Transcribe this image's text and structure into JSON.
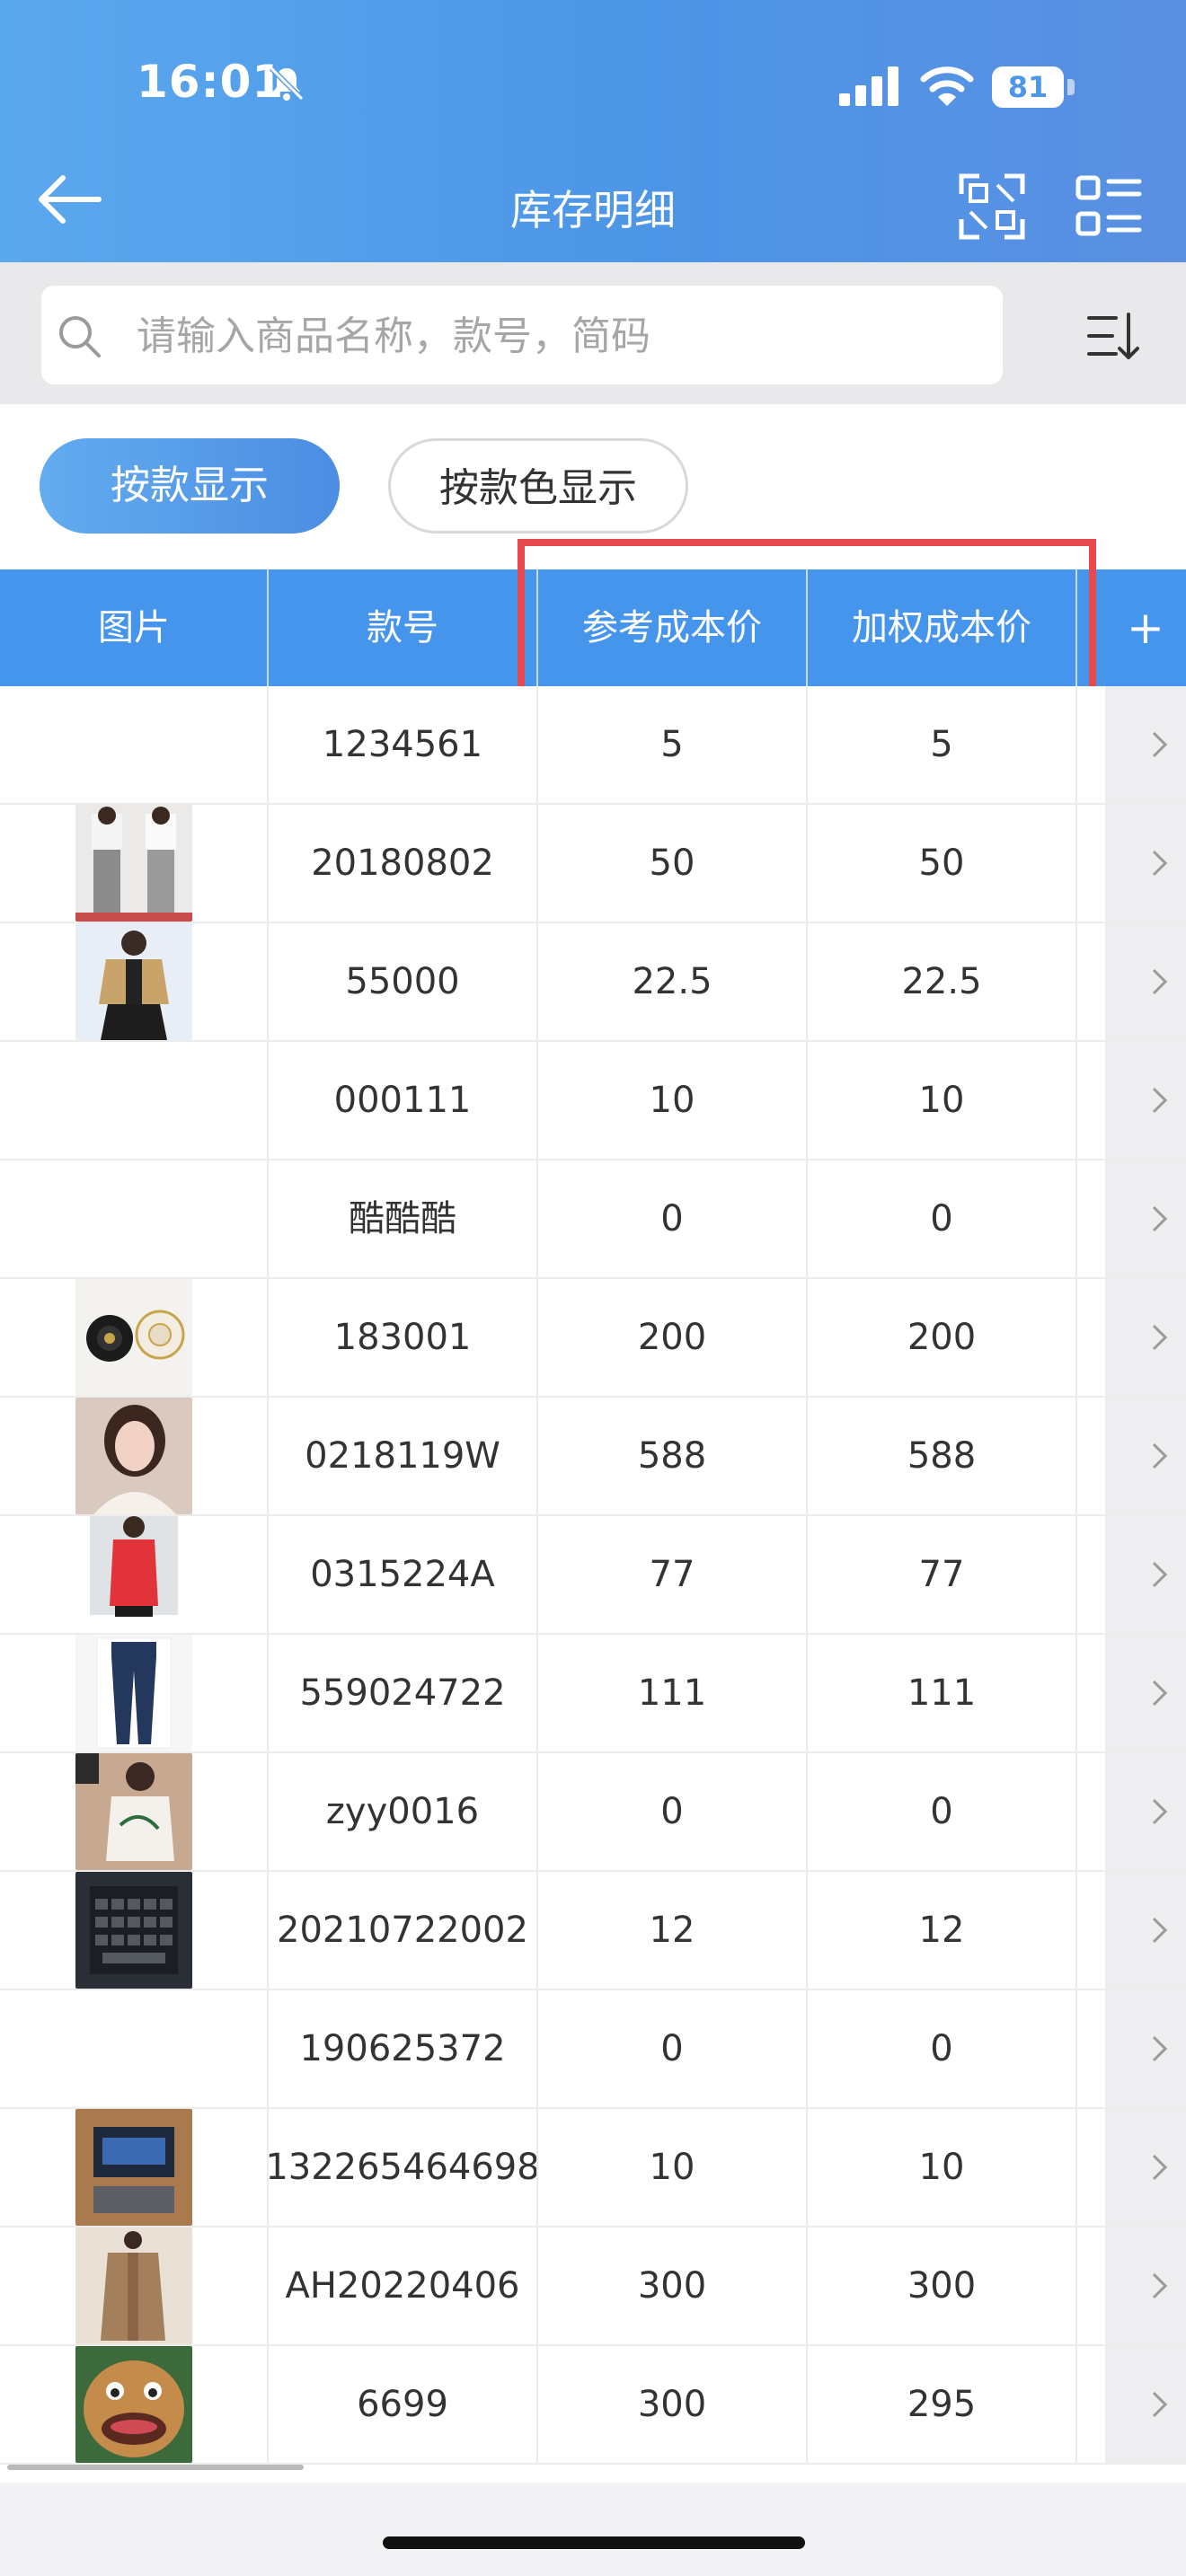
{
  "status_bar": {
    "time": "16:01",
    "battery": "81"
  },
  "header": {
    "title": "库存明细"
  },
  "search": {
    "placeholder": "请输入商品名称，款号，简码"
  },
  "view_toggle": {
    "by_style": "按款显示",
    "by_style_color": "按款色显示"
  },
  "table": {
    "columns": [
      "图片",
      "款号",
      "参考成本价",
      "加权成本价"
    ],
    "add_column": "+",
    "rows": [
      {
        "code": "1234561",
        "ref_cost": "5",
        "wavg_cost": "5",
        "thumb": "none"
      },
      {
        "code": "20180802",
        "ref_cost": "50",
        "wavg_cost": "50",
        "thumb": "pants-photo"
      },
      {
        "code": "55000",
        "ref_cost": "22.5",
        "wavg_cost": "22.5",
        "thumb": "coat-photo"
      },
      {
        "code": "000111",
        "ref_cost": "10",
        "wavg_cost": "10",
        "thumb": "none"
      },
      {
        "code": "酷酷酷",
        "ref_cost": "0",
        "wavg_cost": "0",
        "thumb": "none"
      },
      {
        "code": "183001",
        "ref_cost": "200",
        "wavg_cost": "200",
        "thumb": "brooch-photo"
      },
      {
        "code": "0218119W",
        "ref_cost": "588",
        "wavg_cost": "588",
        "thumb": "portrait-photo"
      },
      {
        "code": "0315224A",
        "ref_cost": "77",
        "wavg_cost": "77",
        "thumb": "red-top-photo"
      },
      {
        "code": "559024722",
        "ref_cost": "111",
        "wavg_cost": "111",
        "thumb": "jeans-photo"
      },
      {
        "code": "zyy0016",
        "ref_cost": "0",
        "wavg_cost": "0",
        "thumb": "tshirt-photo"
      },
      {
        "code": "20210722002",
        "ref_cost": "12",
        "wavg_cost": "12",
        "thumb": "keyboard-photo"
      },
      {
        "code": "190625372",
        "ref_cost": "0",
        "wavg_cost": "0",
        "thumb": "none"
      },
      {
        "code": "132265464698",
        "ref_cost": "10",
        "wavg_cost": "10",
        "thumb": "screen-photo"
      },
      {
        "code": "AH20220406",
        "ref_cost": "300",
        "wavg_cost": "300",
        "thumb": "trench-coat-photo"
      },
      {
        "code": "6699",
        "ref_cost": "300",
        "wavg_cost": "295",
        "thumb": "cartoon-bear-photo"
      }
    ]
  },
  "colors": {
    "header_blue": "#4d95e6",
    "table_header": "#4595ec",
    "highlight_red": "#e64a4f"
  }
}
